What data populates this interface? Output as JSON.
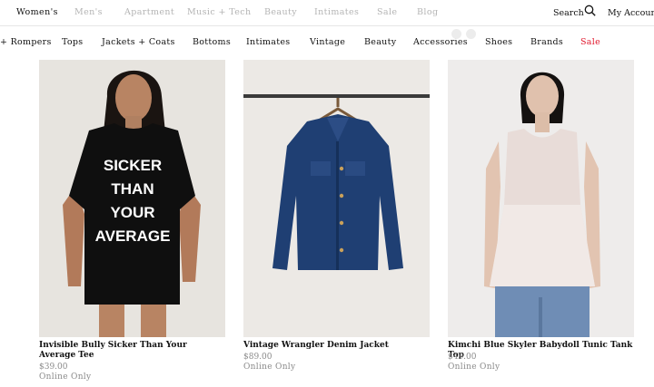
{
  "top_nav": {
    "items": [
      {
        "label": "Women's",
        "active": true
      },
      {
        "label": "Men's",
        "active": false
      },
      {
        "label": "Apartment",
        "active": false
      },
      {
        "label": "Music + Tech",
        "active": false
      },
      {
        "label": "Beauty",
        "active": false
      },
      {
        "label": "Intimates",
        "active": false
      },
      {
        "label": "Sale",
        "active": false
      },
      {
        "label": "Blog",
        "active": false
      }
    ],
    "search_label": "Search",
    "account_label": "My Account"
  },
  "category_nav": {
    "items": [
      "+ Rompers",
      "Tops",
      "Jackets + Coats",
      "Bottoms",
      "Intimates",
      "Vintage",
      "Beauty",
      "Accessories",
      "Shoes",
      "Brands",
      "Sale"
    ]
  },
  "products": [
    {
      "name": "Invisible Bully Sicker Than Your Average Tee",
      "price": "$39.00",
      "availability": "Online Only",
      "shirt_text": [
        "SICKER",
        "THAN",
        "YOUR",
        "AVERAGE"
      ]
    },
    {
      "name": "Vintage Wrangler Denim Jacket",
      "price": "$89.00",
      "availability": "Online Only"
    },
    {
      "name": "Kimchi Blue Skyler Babydoll Tunic Tank Top",
      "price": "$49.00",
      "availability": "Online Only"
    }
  ],
  "colors": {
    "sale": "#e0162b",
    "inactive_nav": "#b4b4b4",
    "price": "#8a8a8a"
  }
}
